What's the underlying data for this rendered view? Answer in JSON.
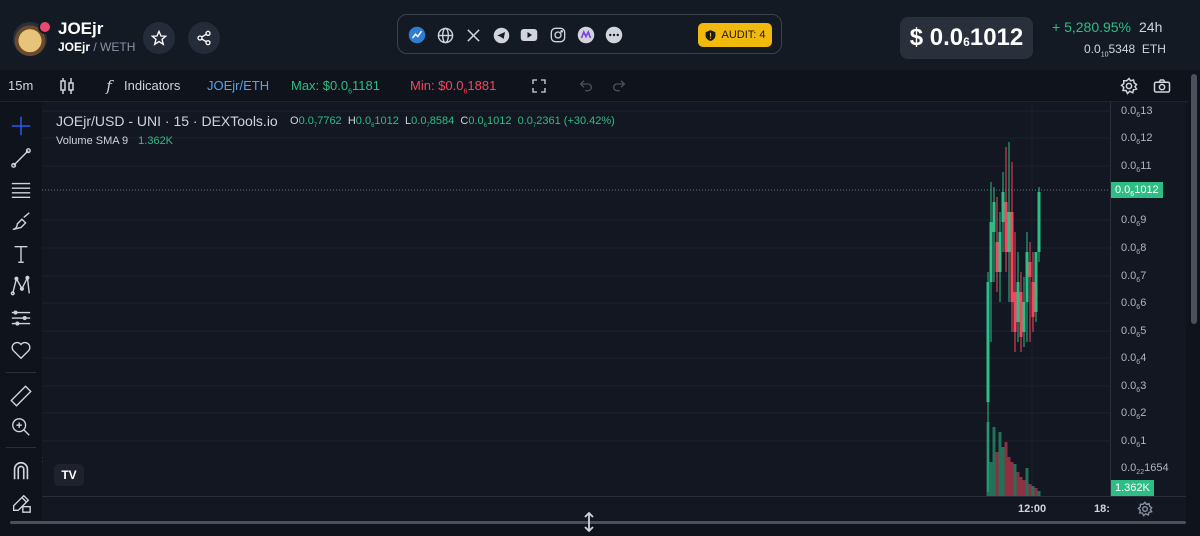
{
  "header": {
    "token_name": "JOEjr",
    "pair_base": "JOEjr",
    "pair_sep": " / ",
    "pair_quote": "WETH",
    "audit_label": "AUDIT: 4",
    "price_prefix": "$ 0.0",
    "price_zeros": "6",
    "price_digits": "1012",
    "change_pct": "+ 5,280.95%",
    "change_period": "24h",
    "eth_prefix": "0.0",
    "eth_zeros": "10",
    "eth_digits": "5348",
    "eth_unit": "ETH",
    "social_icons": [
      "chart-icon",
      "globe-icon",
      "x-icon",
      "telegram-icon",
      "youtube-icon",
      "instagram-icon",
      "medium-icon",
      "more-icon"
    ]
  },
  "toolbar": {
    "interval": "15m",
    "indicators_label": "Indicators",
    "pair_label": "JOEjr/ETH",
    "max_prefix": "Max: $0.0",
    "max_zeros": "6",
    "max_digits": "1181",
    "min_prefix": "Min: $0.0",
    "min_zeros": "6",
    "min_digits": "1881"
  },
  "chart": {
    "title": "JOEjr/USD - UNI · 15 · DEXTools.io",
    "ohlc": {
      "o_label": "O",
      "o_prefix": "0.0",
      "o_zeros": "7",
      "o_digits": "7762",
      "h_label": "H",
      "h_prefix": "0.0",
      "h_zeros": "6",
      "h_digits": "1012",
      "l_label": "L",
      "l_prefix": "0.0",
      "l_zeros": "7",
      "l_digits": "8584",
      "c_label": "C",
      "c_prefix": "0.0",
      "c_zeros": "6",
      "c_digits": "1012",
      "chg_prefix": "0.0",
      "chg_zeros": "7",
      "chg_digits": "2361",
      "chg_pct": "(+30.42%)"
    },
    "volume_label": "Volume SMA 9",
    "volume_value": "1.362K",
    "tv_logo": "TV",
    "price_axis": [
      {
        "prefix": "0.0",
        "zeros": "6",
        "digits": "13"
      },
      {
        "prefix": "0.0",
        "zeros": "6",
        "digits": "12"
      },
      {
        "prefix": "0.0",
        "zeros": "6",
        "digits": "11"
      },
      {
        "prefix": "0.0",
        "zeros": "6",
        "digits": "9"
      },
      {
        "prefix": "0.0",
        "zeros": "6",
        "digits": "8"
      },
      {
        "prefix": "0.0",
        "zeros": "6",
        "digits": "7"
      },
      {
        "prefix": "0.0",
        "zeros": "6",
        "digits": "6"
      },
      {
        "prefix": "0.0",
        "zeros": "6",
        "digits": "5"
      },
      {
        "prefix": "0.0",
        "zeros": "6",
        "digits": "4"
      },
      {
        "prefix": "0.0",
        "zeros": "6",
        "digits": "3"
      },
      {
        "prefix": "0.0",
        "zeros": "6",
        "digits": "2"
      },
      {
        "prefix": "0.0",
        "zeros": "6",
        "digits": "1"
      },
      {
        "prefix": "0.0",
        "zeros": "22",
        "digits": "1654"
      }
    ],
    "current_price_tag": {
      "prefix": "0.0",
      "zeros": "6",
      "digits": "1012"
    },
    "volume_tag": "1.362K",
    "time_labels": [
      "12:00",
      "18:"
    ],
    "colors": {
      "up": "#2ebd85",
      "down": "#f6465d",
      "background": "#131722"
    }
  }
}
